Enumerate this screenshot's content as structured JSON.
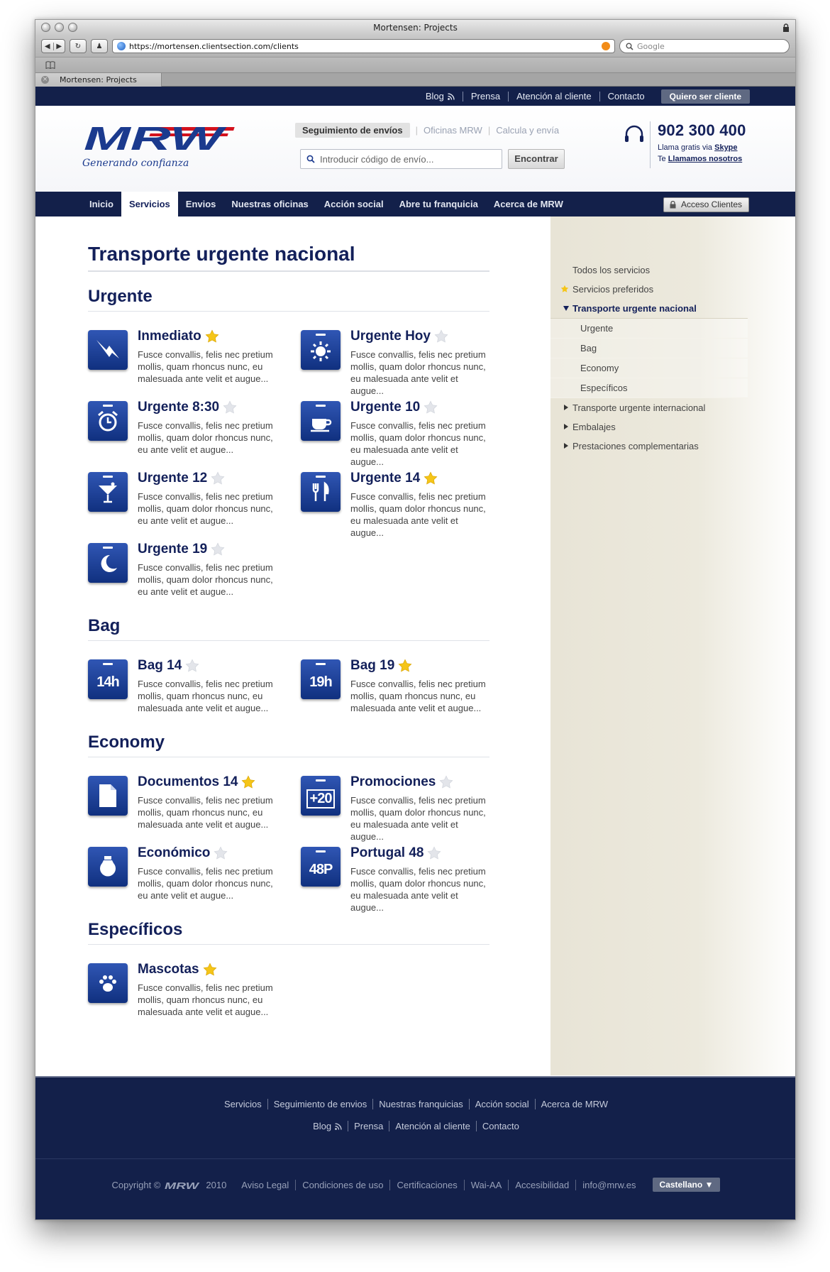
{
  "browser": {
    "window_title": "Mortensen: Projects",
    "url": "https://mortensen.clientsection.com/clients",
    "search_placeholder": "Google",
    "tab_label": "Mortensen: Projects"
  },
  "utility_nav": {
    "items": [
      "Blog",
      "Prensa",
      "Atención al cliente",
      "Contacto"
    ],
    "cta": "Quiero ser cliente"
  },
  "header": {
    "logo_text": "MRW",
    "tagline": "Generando confianza",
    "tracking_tabs": [
      "Seguimiento de envíos",
      "Oficinas MRW",
      "Calcula y envía"
    ],
    "tracking_placeholder": "Introducir código de envío...",
    "tracking_button": "Encontrar",
    "phone": "902 300 400",
    "phone_line1_prefix": "Llama gratis via",
    "phone_line1_link": "Skype",
    "phone_line2_prefix": "Te",
    "phone_line2_link": "Llamamos nosotros"
  },
  "main_nav": {
    "items": [
      "Inicio",
      "Servicios",
      "Envios",
      "Nuestras oficinas",
      "Acción social",
      "Abre tu franquicia",
      "Acerca de MRW"
    ],
    "active_index": 1,
    "client_access": "Acceso Clientes"
  },
  "page": {
    "title": "Transporte urgente nacional",
    "sections": [
      {
        "title": "Urgente",
        "services": [
          {
            "name": "Inmediato",
            "fav": true,
            "icon": "lightning-icon",
            "desc": "Fusce convallis, felis nec pretium mollis, quam rhoncus nunc, eu malesuada ante velit et augue..."
          },
          {
            "name": "Urgente Hoy",
            "fav": false,
            "icon": "sun-icon",
            "desc": "Fusce convallis, felis nec pretium mollis, quam dolor rhoncus nunc, eu malesuada ante velit et augue..."
          },
          {
            "name": "Urgente 8:30",
            "fav": false,
            "icon": "alarm-clock-icon",
            "desc": "Fusce convallis, felis nec pretium mollis, quam dolor rhoncus nunc, eu ante velit et augue..."
          },
          {
            "name": "Urgente 10",
            "fav": false,
            "icon": "coffee-cup-icon",
            "desc": "Fusce convallis, felis nec pretium mollis, quam dolor rhoncus nunc, eu malesuada ante velit et augue..."
          },
          {
            "name": "Urgente 12",
            "fav": false,
            "icon": "cocktail-icon",
            "desc": "Fusce convallis, felis nec pretium mollis, quam dolor rhoncus nunc, eu ante velit et augue..."
          },
          {
            "name": "Urgente 14",
            "fav": true,
            "icon": "fork-knife-icon",
            "desc": "Fusce convallis, felis nec pretium mollis, quam dolor rhoncus nunc, eu malesuada ante velit et augue..."
          },
          {
            "name": "Urgente 19",
            "fav": false,
            "icon": "moon-icon",
            "desc": "Fusce convallis, felis nec pretium mollis, quam dolor rhoncus nunc, eu ante velit et augue..."
          }
        ]
      },
      {
        "title": "Bag",
        "services": [
          {
            "name": "Bag 14",
            "fav": false,
            "icon": "bag-14h-icon",
            "icon_text": "14h",
            "desc": "Fusce convallis, felis nec pretium mollis, quam rhoncus nunc, eu malesuada ante velit et augue..."
          },
          {
            "name": "Bag 19",
            "fav": true,
            "icon": "bag-19h-icon",
            "icon_text": "19h",
            "desc": "Fusce convallis, felis nec pretium mollis, quam rhoncus nunc, eu malesuada ante velit et augue..."
          }
        ]
      },
      {
        "title": "Economy",
        "services": [
          {
            "name": "Documentos 14",
            "fav": true,
            "icon": "document-icon",
            "desc": "Fusce convallis, felis nec pretium mollis, quam rhoncus nunc, eu malesuada ante velit et augue..."
          },
          {
            "name": "Promociones",
            "fav": false,
            "icon": "promo-plus20-icon",
            "icon_text": "+20",
            "desc": "Fusce convallis, felis nec pretium mollis, quam dolor rhoncus nunc, eu malesuada ante velit et augue..."
          },
          {
            "name": "Económico",
            "fav": false,
            "icon": "piggy-jar-icon",
            "desc": "Fusce convallis, felis nec pretium mollis, quam dolor rhoncus nunc, eu ante velit et augue..."
          },
          {
            "name": "Portugal 48",
            "fav": false,
            "icon": "portugal-48p-icon",
            "icon_text": "48P",
            "desc": "Fusce convallis, felis nec pretium mollis, quam dolor rhoncus nunc, eu malesuada ante velit et augue..."
          }
        ]
      },
      {
        "title": "Específicos",
        "services": [
          {
            "name": "Mascotas",
            "fav": true,
            "icon": "paw-icon",
            "desc": "Fusce convallis, felis nec pretium mollis, quam rhoncus nunc, eu malesuada ante velit et augue..."
          }
        ]
      }
    ]
  },
  "sidebar": {
    "all": "Todos los servicios",
    "favorites": "Servicios preferidos",
    "current": "Transporte urgente nacional",
    "sub_items": [
      "Urgente",
      "Bag",
      "Economy",
      "Específicos"
    ],
    "collapsed": [
      "Transporte urgente internacional",
      "Embalajes",
      "Prestaciones complementarias"
    ]
  },
  "footer": {
    "row1": [
      "Servicios",
      "Seguimiento de envios",
      "Nuestras franquicias",
      "Acción social",
      "Acerca de MRW"
    ],
    "row2": [
      "Blog",
      "Prensa",
      "Atención al cliente",
      "Contacto"
    ],
    "copyright_prefix": "Copyright ©",
    "copyright_year": "2010",
    "links": [
      "Aviso Legal",
      "Condiciones de uso",
      "Certificaciones",
      "Wai-AA",
      "Accesibilidad",
      "info@mrw.es"
    ],
    "language": "Castellano"
  },
  "colors": {
    "navy": "#13204a",
    "brand_blue": "#1b3a8e",
    "brand_red": "#d4121e",
    "star_gold": "#f5c518",
    "star_off": "#e3e5ea"
  }
}
